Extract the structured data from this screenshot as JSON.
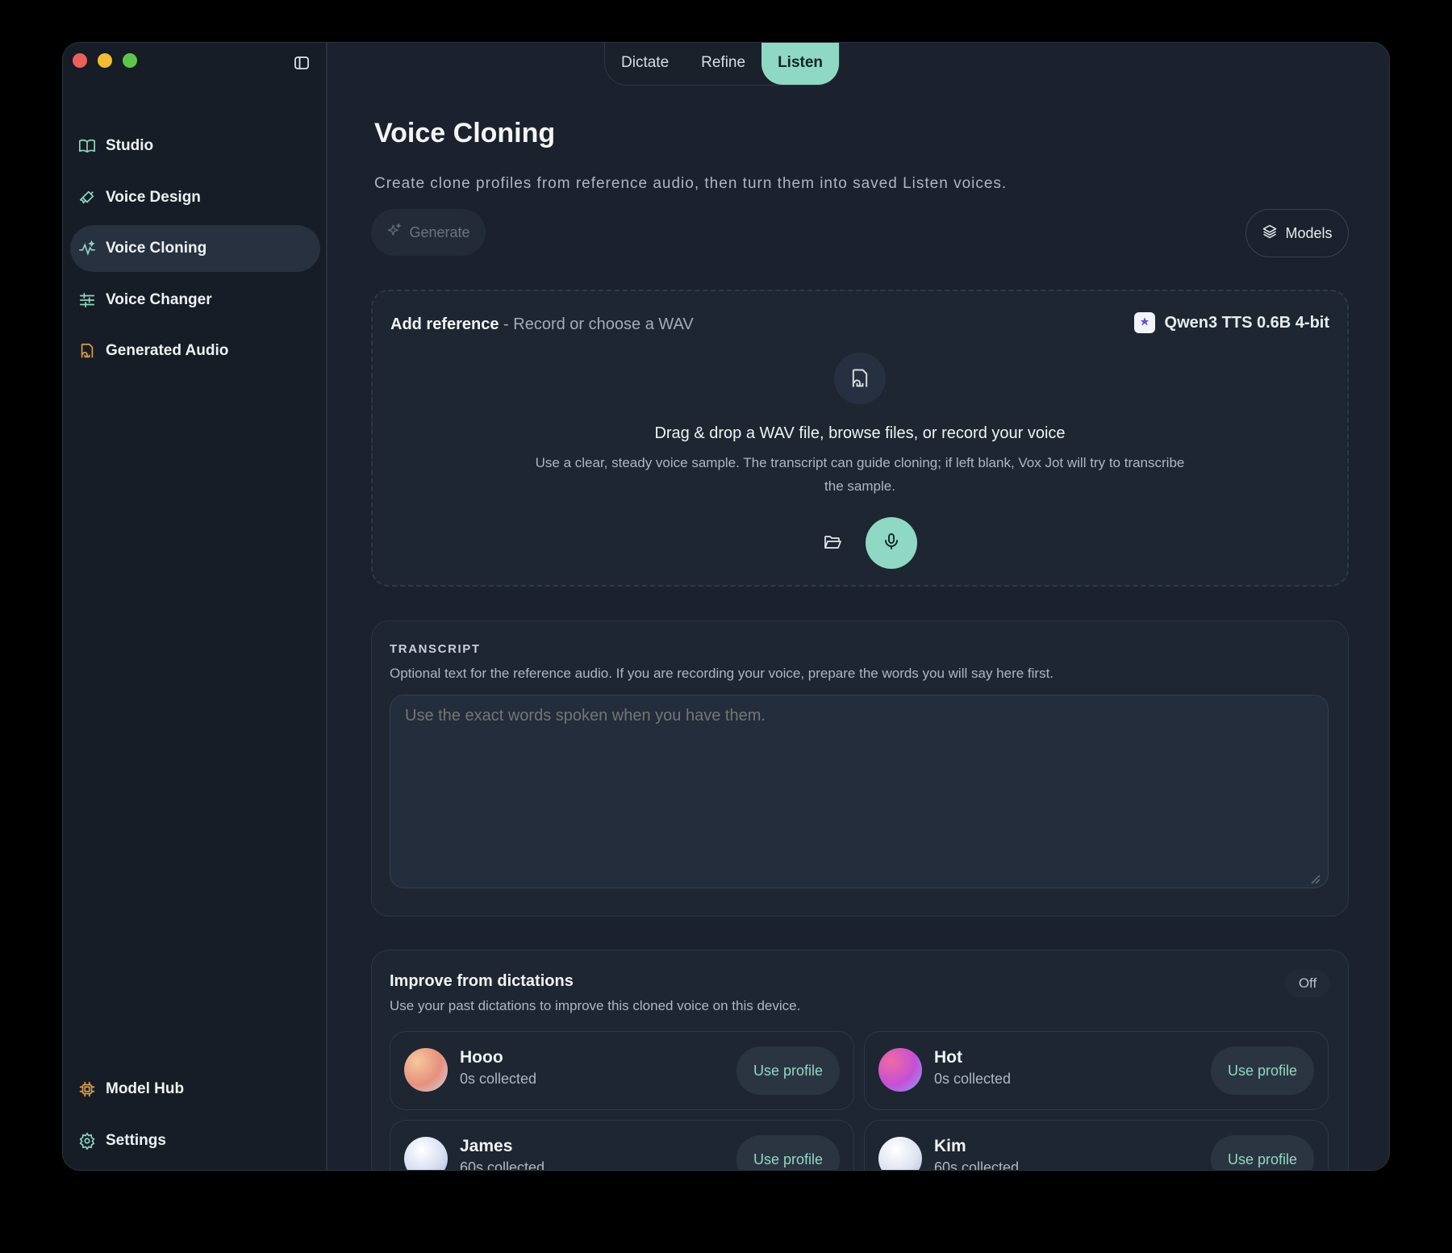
{
  "sidebar": {
    "items": [
      {
        "label": "Studio",
        "icon": "book-icon"
      },
      {
        "label": "Voice Design",
        "icon": "brush-icon"
      },
      {
        "label": "Voice Cloning",
        "icon": "sparkle-wave-icon",
        "active": true
      },
      {
        "label": "Voice Changer",
        "icon": "sliders-icon"
      },
      {
        "label": "Generated Audio",
        "icon": "audio-file-icon"
      }
    ],
    "bottom_items": [
      {
        "label": "Model Hub",
        "icon": "chip-icon"
      },
      {
        "label": "Settings",
        "icon": "gear-icon"
      }
    ]
  },
  "tabs": [
    {
      "label": "Dictate"
    },
    {
      "label": "Refine"
    },
    {
      "label": "Listen",
      "active": true
    }
  ],
  "page": {
    "title": "Voice Cloning",
    "subtitle": "Create clone profiles from reference audio, then turn them into saved Listen voices.",
    "generate_label": "Generate",
    "models_label": "Models"
  },
  "dropzone": {
    "title_bold": "Add reference",
    "title_rest": " - Record or choose a WAV",
    "model": "Qwen3 TTS 0.6B 4-bit",
    "heading": "Drag & drop a WAV file, browse files, or record your voice",
    "description": "Use a clear, steady voice sample. The transcript can guide cloning; if left blank, Vox Jot will try to transcribe the sample."
  },
  "transcript": {
    "label": "TRANSCRIPT",
    "help": "Optional text for the reference audio. If you are recording your voice, prepare the words you will say here first.",
    "placeholder": "Use the exact words spoken when you have them."
  },
  "improve": {
    "title": "Improve from dictations",
    "toggle": "Off",
    "description": "Use your past dictations to improve this cloned voice on this device.",
    "profiles": [
      {
        "name": "Hooo",
        "collected": "0s collected",
        "button": "Use profile"
      },
      {
        "name": "Hot",
        "collected": "0s collected",
        "button": "Use profile"
      },
      {
        "name": "James",
        "collected": "60s collected",
        "button": "Use profile"
      },
      {
        "name": "Kim",
        "collected": "60s collected",
        "button": "Use profile"
      }
    ]
  },
  "colors": {
    "accent": "#8fd8c4",
    "background": "#1b222d",
    "sidebar": "#161d26"
  }
}
